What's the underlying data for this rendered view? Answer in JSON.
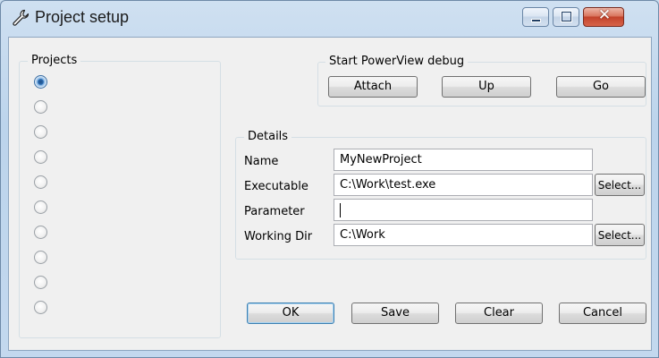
{
  "window": {
    "title": "Project setup",
    "controls": {
      "minimize_icon": "minimize-icon",
      "maximize_icon": "maximize-icon",
      "close_glyph": "✕"
    }
  },
  "projects": {
    "label": "Projects",
    "radios": [
      {
        "checked": true
      },
      {
        "checked": false
      },
      {
        "checked": false
      },
      {
        "checked": false
      },
      {
        "checked": false
      },
      {
        "checked": false
      },
      {
        "checked": false
      },
      {
        "checked": false
      },
      {
        "checked": false
      },
      {
        "checked": false
      }
    ]
  },
  "debug": {
    "label": "Start PowerView debug",
    "buttons": [
      "Attach",
      "Up",
      "Go"
    ]
  },
  "details": {
    "label": "Details",
    "name_label": "Name",
    "name_value": "MyNewProject",
    "executable_label": "Executable",
    "executable_value": "C:\\Work\\test.exe",
    "parameter_label": "Parameter",
    "parameter_value": "",
    "workdir_label": "Working Dir",
    "workdir_value": "C:\\Work",
    "select_label": "Select..."
  },
  "actions": {
    "ok": "OK",
    "save": "Save",
    "clear": "Clear",
    "cancel": "Cancel"
  },
  "colors": {
    "titlebar": "#c3d8ee",
    "client": "#f0f0f0",
    "close_button": "#c2432b",
    "default_button_border": "#3c7fb1"
  }
}
